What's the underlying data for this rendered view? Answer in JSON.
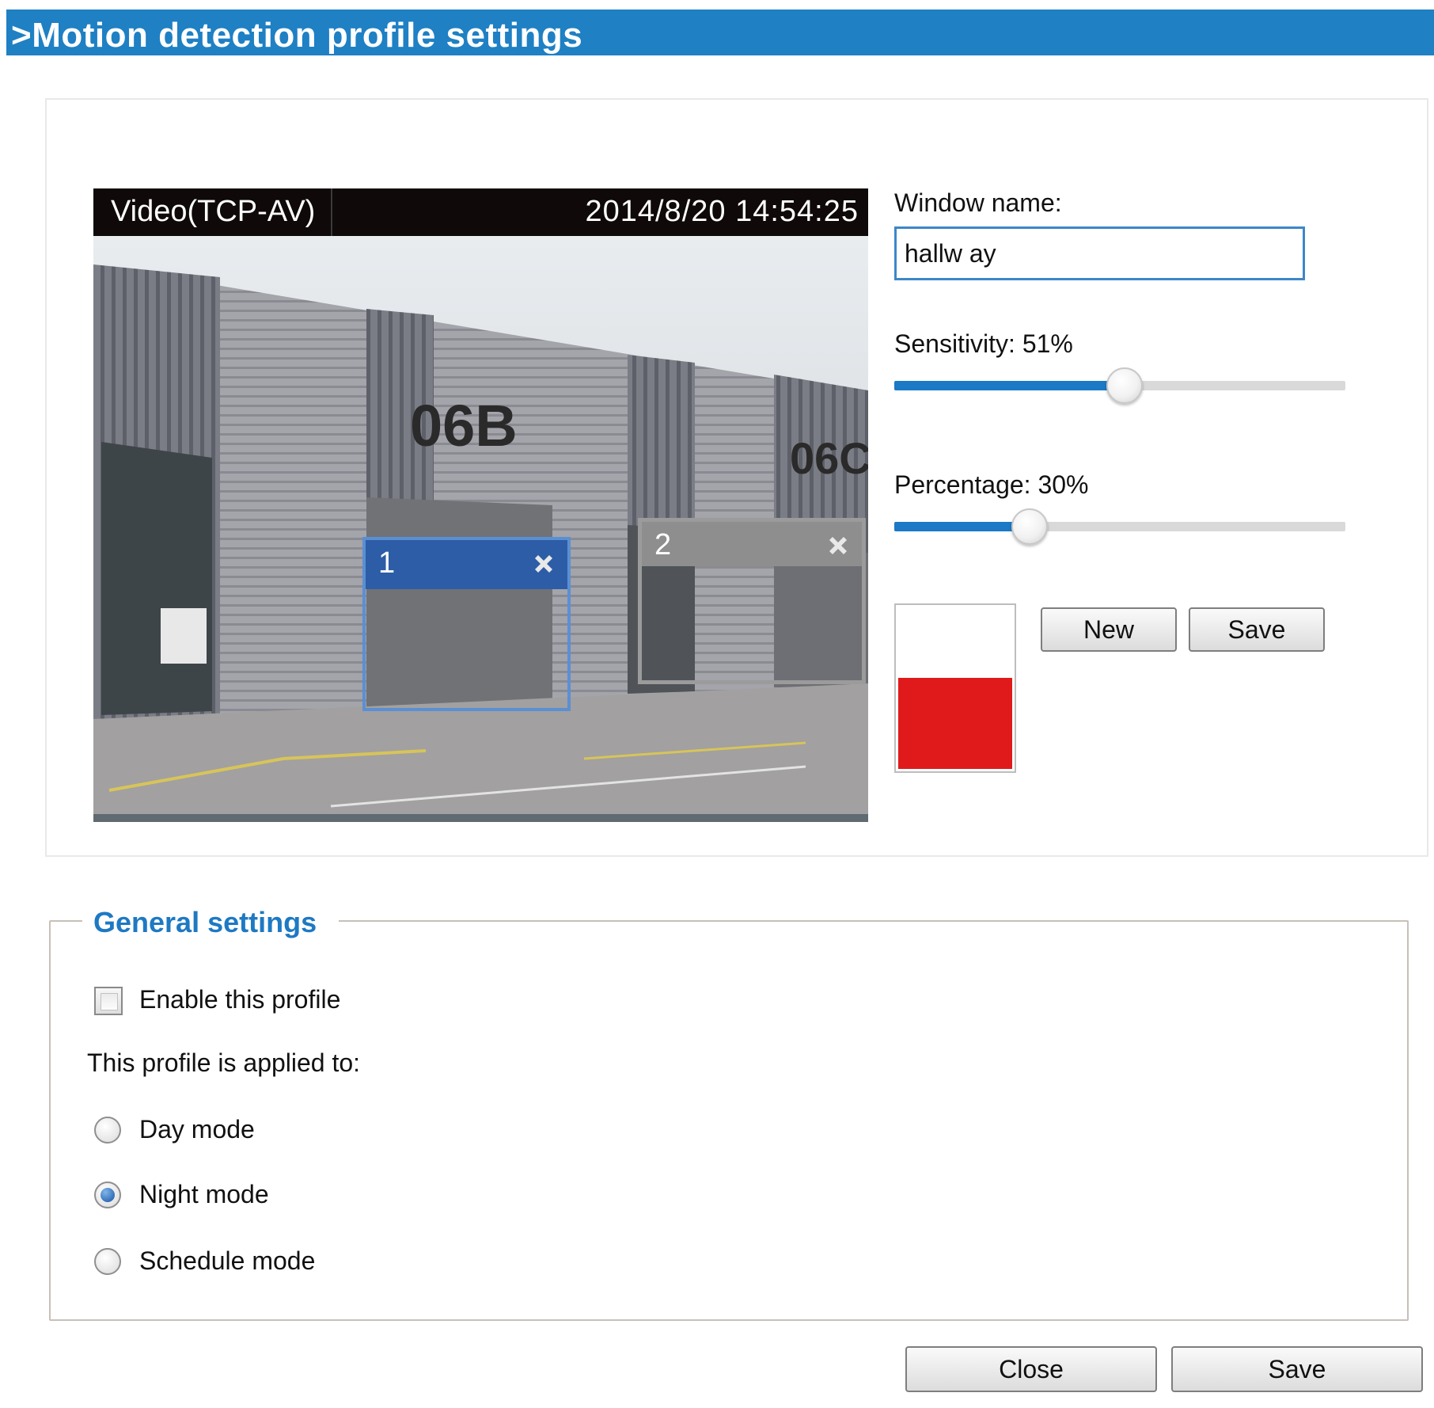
{
  "header": {
    "title": ">Motion detection profile settings"
  },
  "video": {
    "label": "Video(TCP-AV)",
    "timestamp": "2014/8/20 14:54:25",
    "windows": [
      {
        "number": "1",
        "color": "#2c5da6"
      },
      {
        "number": "2",
        "color": "#8e8e8e"
      }
    ]
  },
  "controls": {
    "window_name_label": "Window  name:",
    "window_name_value": "hallw ay",
    "sensitivity_label": "Sensitivity: 51%",
    "sensitivity_percent": 51,
    "percentage_label": "Percentage: 30%",
    "percentage_percent": 30,
    "activity_level_percent": 55,
    "new_label": "New",
    "save_label": "Save"
  },
  "general": {
    "legend": "General settings",
    "enable_label": "Enable this profile",
    "enable_checked": false,
    "applied_label": "This profile is applied to:",
    "modes": [
      {
        "label": "Day mode",
        "checked": false
      },
      {
        "label": "Night mode",
        "checked": true
      },
      {
        "label": "Schedule mode",
        "checked": false
      }
    ]
  },
  "footer": {
    "close_label": "Close",
    "save_label": "Save"
  },
  "colors": {
    "accent": "#1f80c4",
    "legend": "#1e79c3",
    "meter": "#e01a1a",
    "window1": "#2c5da6",
    "window2": "#8e8e8e"
  },
  "icons": {
    "window_close": "close-x-icon"
  }
}
